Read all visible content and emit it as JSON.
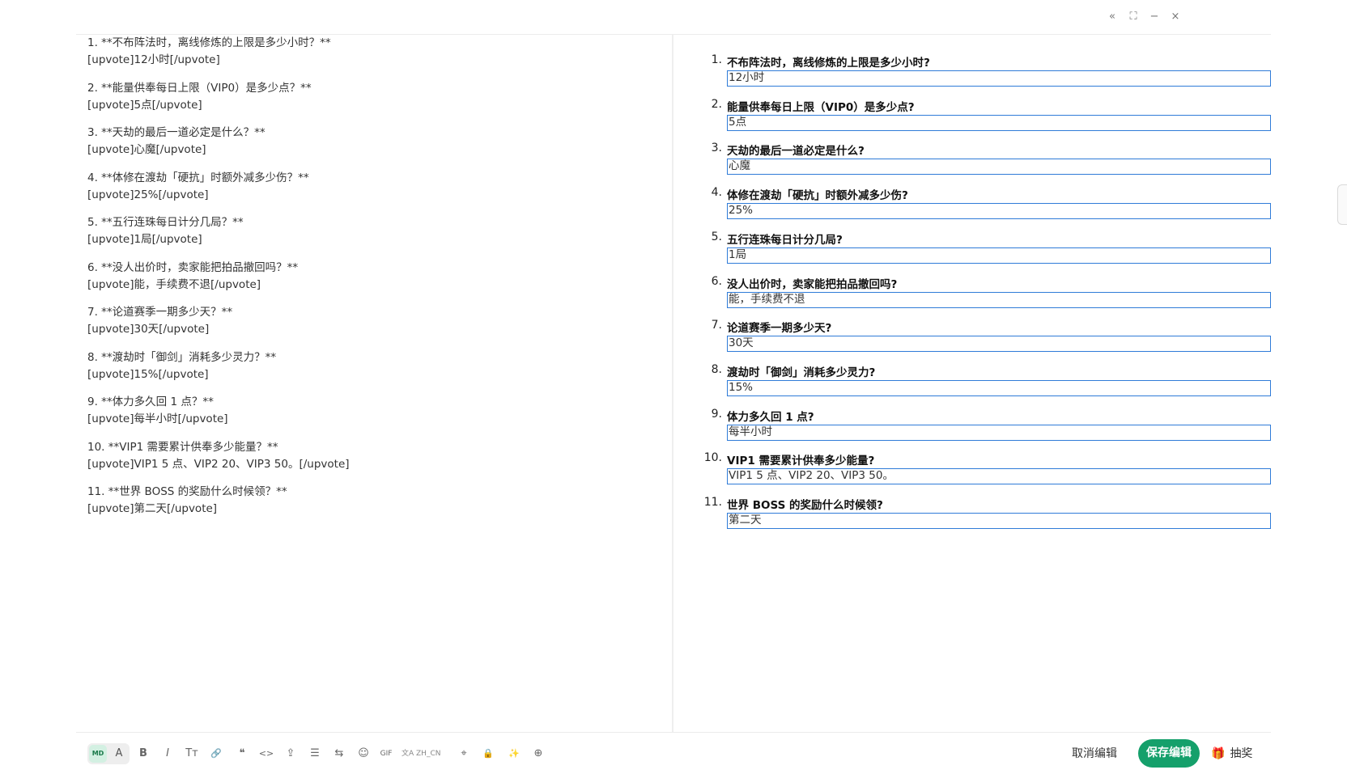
{
  "window": {
    "collapse_icon": "«",
    "fullscreen_icon": "⛶",
    "minimize_icon": "−",
    "close_icon": "×"
  },
  "source_lines": [
    [
      "1. **不布阵法时，离线修炼的上限是多少小时？**",
      "[upvote]12小时[/upvote]"
    ],
    [
      "2. **能量供奉每日上限（VIP0）是多少点？**",
      "[upvote]5点[/upvote]"
    ],
    [
      "3. **天劫的最后一道必定是什么？**",
      "[upvote]心魔[/upvote]"
    ],
    [
      "4. **体修在渡劫「硬抗」时额外减多少伤？**",
      "[upvote]25%[/upvote]"
    ],
    [
      "5. **五行连珠每日计分几局？**",
      "[upvote]1局[/upvote]"
    ],
    [
      "6. **没人出价时，卖家能把拍品撤回吗？**",
      "[upvote]能，手续费不退[/upvote]"
    ],
    [
      "7. **论道赛季一期多少天？**",
      "[upvote]30天[/upvote]"
    ],
    [
      "8. **渡劫时「御剑」消耗多少灵力？**",
      "[upvote]15%[/upvote]"
    ],
    [
      "9. **体力多久回 1 点？**",
      "[upvote]每半小时[/upvote]"
    ],
    [
      "10. **VIP1 需要累计供奉多少能量？**",
      "[upvote]VIP1 5 点、VIP2 20、VIP3 50。[/upvote]"
    ],
    [
      "11. **世界 BOSS 的奖励什么时候领？**",
      "[upvote]第二天[/upvote]"
    ]
  ],
  "preview": [
    {
      "num": "1.",
      "question": "不布阵法时，离线修炼的上限是多少小时?",
      "answer": "12小时"
    },
    {
      "num": "2.",
      "question": "能量供奉每日上限（VIP0）是多少点?",
      "answer": "5点"
    },
    {
      "num": "3.",
      "question": "天劫的最后一道必定是什么?",
      "answer": "心魔"
    },
    {
      "num": "4.",
      "question": "体修在渡劫「硬抗」时额外减多少伤?",
      "answer": "25%"
    },
    {
      "num": "5.",
      "question": "五行连珠每日计分几局?",
      "answer": "1局"
    },
    {
      "num": "6.",
      "question": "没人出价时，卖家能把拍品撤回吗?",
      "answer": "能，手续费不退"
    },
    {
      "num": "7.",
      "question": "论道赛季一期多少天?",
      "answer": "30天"
    },
    {
      "num": "8.",
      "question": "渡劫时「御剑」消耗多少灵力?",
      "answer": "15%"
    },
    {
      "num": "9.",
      "question": "体力多久回 1 点?",
      "answer": "每半小时"
    },
    {
      "num": "10.",
      "question": "VIP1 需要累计供奉多少能量?",
      "answer": "VIP1 5 点、VIP2 20、VIP3 50。"
    },
    {
      "num": "11.",
      "question": "世界 BOSS 的奖励什么时候领?",
      "answer": "第二天"
    }
  ],
  "toolbar": {
    "mode_markdown": "MD",
    "mode_rich": "A",
    "bold": "B",
    "italic": "I",
    "heading": "Tт",
    "link": "🔗",
    "quote": "❝",
    "code": "<>",
    "upload": "⇪",
    "list": "☰",
    "swap": "⇆",
    "emoji": "☺",
    "gif": "GIF",
    "language": "文A ZH_CN",
    "pin": "⌖",
    "lock": "🔒",
    "magic": "✨",
    "more": "⊕"
  },
  "actions": {
    "cancel_label": "取消编辑",
    "save_label": "保存编辑",
    "lottery_label": "抽奖",
    "lottery_icon": "🎁"
  },
  "colors": {
    "accent": "#15a06b",
    "input_border": "#2f7bd8"
  }
}
